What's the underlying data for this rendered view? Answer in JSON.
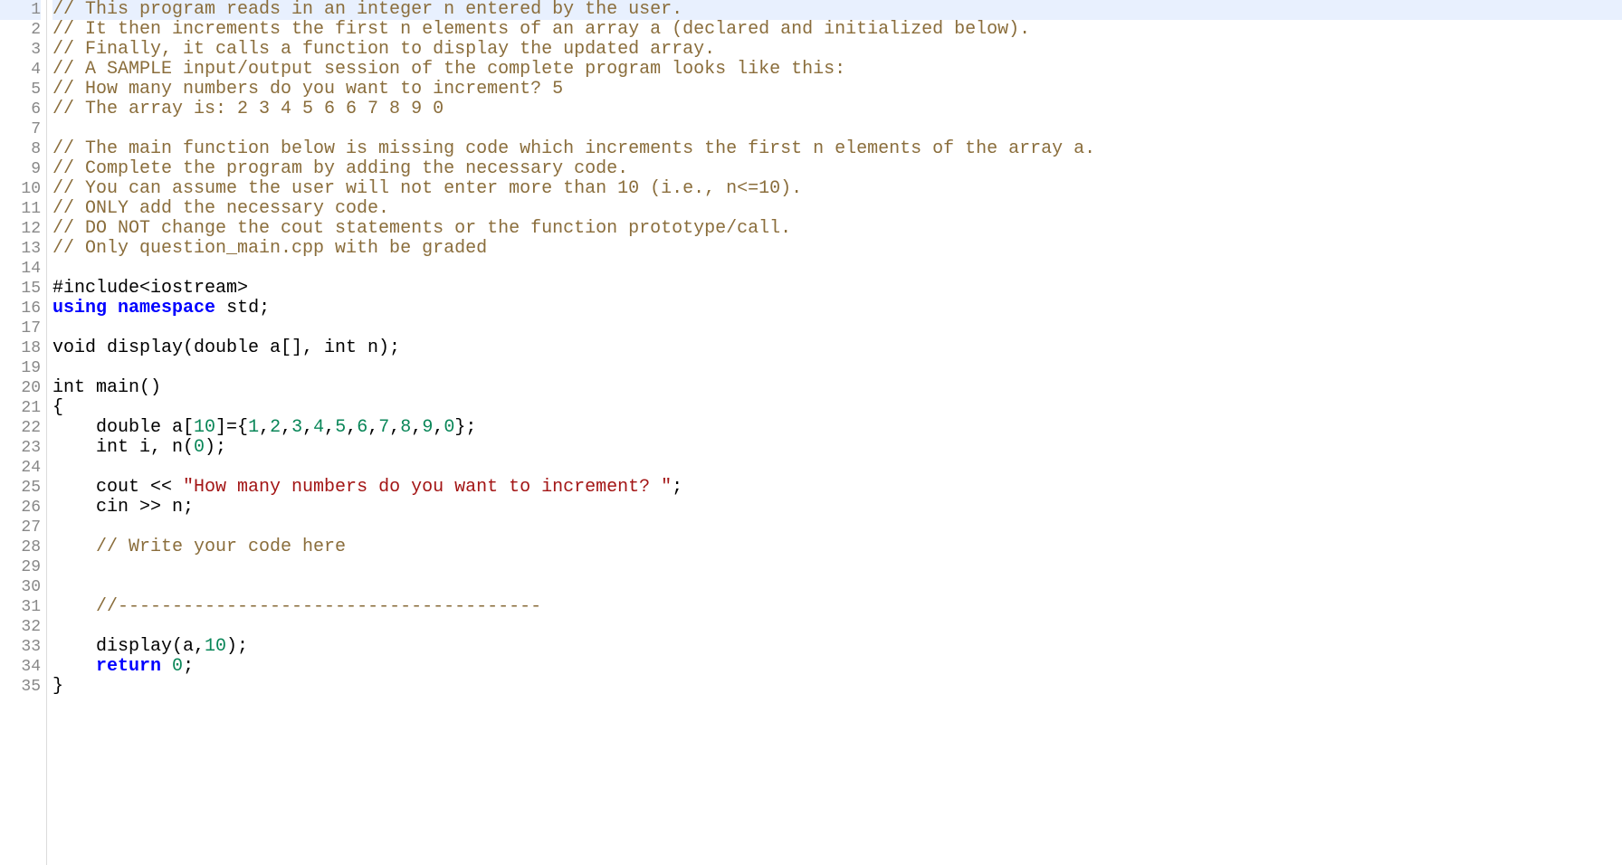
{
  "editor": {
    "total_lines": 35,
    "current_line": 1,
    "lines": [
      {
        "n": 1,
        "tokens": [
          {
            "c": "cm",
            "t": "// This program reads in an integer n entered by the user."
          }
        ]
      },
      {
        "n": 2,
        "tokens": [
          {
            "c": "cm",
            "t": "// It then increments the first n elements of an array a (declared and initialized below)."
          }
        ]
      },
      {
        "n": 3,
        "tokens": [
          {
            "c": "cm",
            "t": "// Finally, it calls a function to display the updated array."
          }
        ]
      },
      {
        "n": 4,
        "tokens": [
          {
            "c": "cm",
            "t": "// A SAMPLE input/output session of the complete program looks like this:"
          }
        ]
      },
      {
        "n": 5,
        "tokens": [
          {
            "c": "cm",
            "t": "// How many numbers do you want to increment? 5"
          }
        ]
      },
      {
        "n": 6,
        "tokens": [
          {
            "c": "cm",
            "t": "// The array is: 2 3 4 5 6 6 7 8 9 0"
          }
        ]
      },
      {
        "n": 7,
        "tokens": []
      },
      {
        "n": 8,
        "tokens": [
          {
            "c": "cm",
            "t": "// The main function below is missing code which increments the first n elements of the array a."
          }
        ]
      },
      {
        "n": 9,
        "tokens": [
          {
            "c": "cm",
            "t": "// Complete the program by adding the necessary code."
          }
        ]
      },
      {
        "n": 10,
        "tokens": [
          {
            "c": "cm",
            "t": "// You can assume the user will not enter more than 10 (i.e., n<=10)."
          }
        ]
      },
      {
        "n": 11,
        "tokens": [
          {
            "c": "cm",
            "t": "// ONLY add the necessary code."
          }
        ]
      },
      {
        "n": 12,
        "tokens": [
          {
            "c": "cm",
            "t": "// DO NOT change the cout statements or the function prototype/call."
          }
        ]
      },
      {
        "n": 13,
        "tokens": [
          {
            "c": "cm",
            "t": "// Only question_main.cpp with be graded"
          }
        ]
      },
      {
        "n": 14,
        "tokens": []
      },
      {
        "n": 15,
        "tokens": [
          {
            "c": "id",
            "t": "#include<iostream>"
          }
        ]
      },
      {
        "n": 16,
        "tokens": [
          {
            "c": "kw",
            "t": "using"
          },
          {
            "c": "id",
            "t": " "
          },
          {
            "c": "kw",
            "t": "namespace"
          },
          {
            "c": "id",
            "t": " std;"
          }
        ]
      },
      {
        "n": 17,
        "tokens": []
      },
      {
        "n": 18,
        "tokens": [
          {
            "c": "id",
            "t": "void display(double a[], int n);"
          }
        ]
      },
      {
        "n": 19,
        "tokens": []
      },
      {
        "n": 20,
        "tokens": [
          {
            "c": "id",
            "t": "int main()"
          }
        ]
      },
      {
        "n": 21,
        "tokens": [
          {
            "c": "id",
            "t": "{"
          }
        ]
      },
      {
        "n": 22,
        "tokens": [
          {
            "c": "id",
            "t": "    double a["
          },
          {
            "c": "num",
            "t": "10"
          },
          {
            "c": "id",
            "t": "]={"
          },
          {
            "c": "num",
            "t": "1"
          },
          {
            "c": "id",
            "t": ","
          },
          {
            "c": "num",
            "t": "2"
          },
          {
            "c": "id",
            "t": ","
          },
          {
            "c": "num",
            "t": "3"
          },
          {
            "c": "id",
            "t": ","
          },
          {
            "c": "num",
            "t": "4"
          },
          {
            "c": "id",
            "t": ","
          },
          {
            "c": "num",
            "t": "5"
          },
          {
            "c": "id",
            "t": ","
          },
          {
            "c": "num",
            "t": "6"
          },
          {
            "c": "id",
            "t": ","
          },
          {
            "c": "num",
            "t": "7"
          },
          {
            "c": "id",
            "t": ","
          },
          {
            "c": "num",
            "t": "8"
          },
          {
            "c": "id",
            "t": ","
          },
          {
            "c": "num",
            "t": "9"
          },
          {
            "c": "id",
            "t": ","
          },
          {
            "c": "num",
            "t": "0"
          },
          {
            "c": "id",
            "t": "};"
          }
        ]
      },
      {
        "n": 23,
        "tokens": [
          {
            "c": "id",
            "t": "    int i, n("
          },
          {
            "c": "num",
            "t": "0"
          },
          {
            "c": "id",
            "t": ");"
          }
        ]
      },
      {
        "n": 24,
        "tokens": []
      },
      {
        "n": 25,
        "tokens": [
          {
            "c": "id",
            "t": "    cout << "
          },
          {
            "c": "str",
            "t": "\"How many numbers do you want to increment? \""
          },
          {
            "c": "id",
            "t": ";"
          }
        ]
      },
      {
        "n": 26,
        "tokens": [
          {
            "c": "id",
            "t": "    cin >> n;"
          }
        ]
      },
      {
        "n": 27,
        "tokens": []
      },
      {
        "n": 28,
        "tokens": [
          {
            "c": "id",
            "t": "    "
          },
          {
            "c": "cm",
            "t": "// Write your code here"
          }
        ]
      },
      {
        "n": 29,
        "tokens": []
      },
      {
        "n": 30,
        "tokens": []
      },
      {
        "n": 31,
        "tokens": [
          {
            "c": "id",
            "t": "    "
          },
          {
            "c": "cm",
            "t": "//---------------------------------------"
          }
        ]
      },
      {
        "n": 32,
        "tokens": []
      },
      {
        "n": 33,
        "tokens": [
          {
            "c": "id",
            "t": "    display(a,"
          },
          {
            "c": "num",
            "t": "10"
          },
          {
            "c": "id",
            "t": ");"
          }
        ]
      },
      {
        "n": 34,
        "tokens": [
          {
            "c": "id",
            "t": "    "
          },
          {
            "c": "kw",
            "t": "return"
          },
          {
            "c": "id",
            "t": " "
          },
          {
            "c": "num",
            "t": "0"
          },
          {
            "c": "id",
            "t": ";"
          }
        ]
      },
      {
        "n": 35,
        "tokens": [
          {
            "c": "id",
            "t": "}"
          }
        ]
      }
    ]
  }
}
